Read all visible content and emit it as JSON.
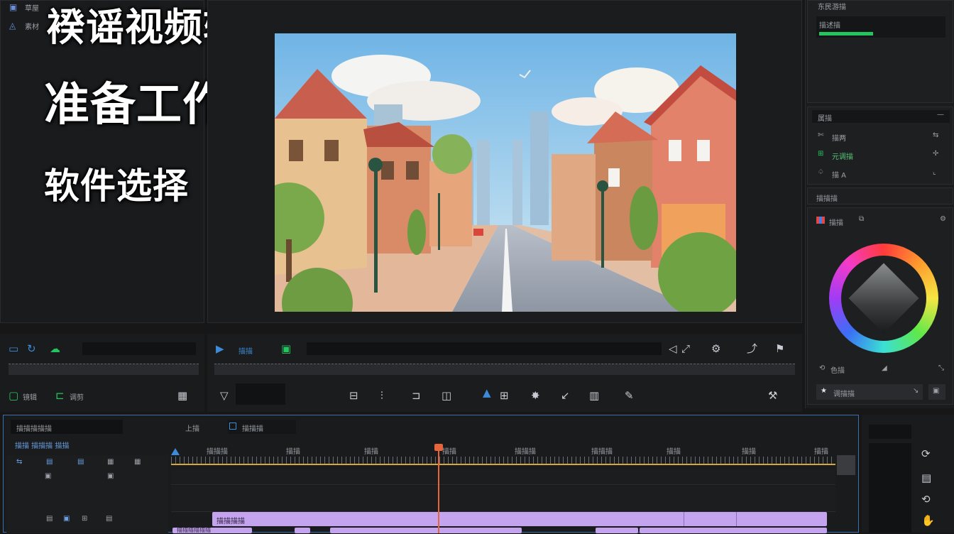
{
  "overlay": {
    "line1": "䙆谣视频辑指南",
    "line2": "准备工作:",
    "line3": "软件选择"
  },
  "left_panel": {
    "items": [
      {
        "label": "草屋"
      },
      {
        "label": "素材"
      }
    ],
    "tool_labels": {
      "a": "镜辑",
      "b": "调剪"
    }
  },
  "right_panel": {
    "section1": {
      "title": "东民游描",
      "item": "描述描"
    },
    "props": {
      "title": "属描",
      "rows": [
        {
          "label": "描两"
        },
        {
          "label": "元调描"
        },
        {
          "label": "描 A"
        }
      ]
    },
    "section3": {
      "title": "描描描"
    },
    "color": {
      "label": "描描",
      "footer": "色描",
      "preset": "调描描"
    }
  },
  "source_monitor": {},
  "program_monitor": {
    "label": "描描"
  },
  "timeline": {
    "sequence_name": "描描描描描",
    "track_header": "描描 描描描 描描",
    "toolbar_left": "上描",
    "toolbar_right": "描描描",
    "clip_top_label": "描描描描",
    "clip_bottom_label": "描描描描描描",
    "time_labels": [
      "描描描",
      "描描",
      "描描",
      "描描",
      "描描描",
      "描描描",
      "描描",
      "描描",
      "描描"
    ]
  },
  "colors": {
    "accent_blue": "#3d8bd8",
    "accent_green": "#22c55e",
    "playhead": "#e8643b",
    "clip_purple": "#c4a3ef",
    "ruler_yellow": "#d6a73a"
  }
}
